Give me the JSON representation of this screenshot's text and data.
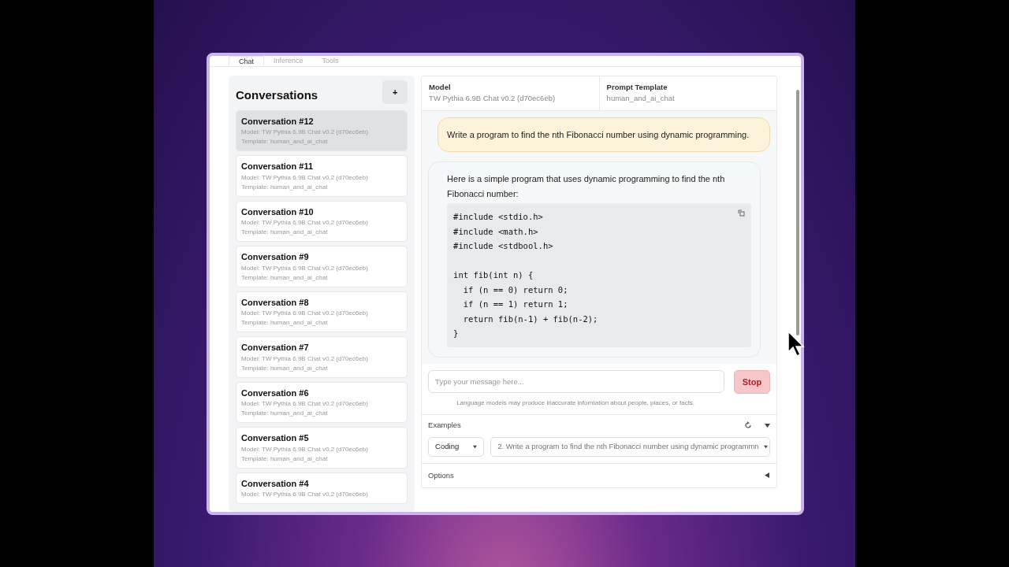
{
  "tabs": [
    {
      "label": "Chat",
      "selected": true
    },
    {
      "label": "Inference",
      "selected": false
    },
    {
      "label": "Tools",
      "selected": false
    }
  ],
  "sidebar": {
    "title": "Conversations",
    "add_button": "+",
    "conversations": [
      {
        "title": "Conversation #12",
        "model": "Model: TW Pythia 6.9B Chat v0.2 (d70ec6eb)",
        "template": "Template: human_and_ai_chat",
        "selected": true
      },
      {
        "title": "Conversation #11",
        "model": "Model: TW Pythia 6.9B Chat v0.2 (d70ec6eb)",
        "template": "Template: human_and_ai_chat",
        "selected": false
      },
      {
        "title": "Conversation #10",
        "model": "Model: TW Pythia 6.9B Chat v0.2 (d70ec6eb)",
        "template": "Template: human_and_ai_chat",
        "selected": false
      },
      {
        "title": "Conversation #9",
        "model": "Model: TW Pythia 6.9B Chat v0.2 (d70ec6eb)",
        "template": "Template: human_and_ai_chat",
        "selected": false
      },
      {
        "title": "Conversation #8",
        "model": "Model: TW Pythia 6.9B Chat v0.2 (d70ec6eb)",
        "template": "Template: human_and_ai_chat",
        "selected": false
      },
      {
        "title": "Conversation #7",
        "model": "Model: TW Pythia 6.9B Chat v0.2 (d70ec6eb)",
        "template": "Template: human_and_ai_chat",
        "selected": false
      },
      {
        "title": "Conversation #6",
        "model": "Model: TW Pythia 6.9B Chat v0.2 (d70ec6eb)",
        "template": "Template: human_and_ai_chat",
        "selected": false
      },
      {
        "title": "Conversation #5",
        "model": "Model: TW Pythia 6.9B Chat v0.2 (d70ec6eb)",
        "template": "Template: human_and_ai_chat",
        "selected": false
      },
      {
        "title": "Conversation #4",
        "model": "Model: TW Pythia 6.9B Chat v0.2 (d70ec6eb)",
        "selected": false
      }
    ]
  },
  "header": {
    "fields": [
      {
        "label": "Model",
        "value": "TW Pythia 6.9B Chat v0.2 (d70ec6eb)"
      },
      {
        "label": "Prompt Template",
        "value": "human_and_ai_chat"
      }
    ]
  },
  "messages": [
    {
      "kind": "user",
      "text": "Write a program to find the nth Fibonacci number using dynamic programming."
    },
    {
      "kind": "assistant",
      "text": "Here is a simple program that uses dynamic programming to find the nth Fibonacci number:",
      "code": "#include <stdio.h>\n#include <math.h>\n#include <stdbool.h>\n\nint fib(int n) {\n  if (n == 0) return 0;\n  if (n == 1) return 1;\n  return fib(n-1) + fib(n-2);\n}"
    }
  ],
  "composer": {
    "placeholder": "Type your message here...",
    "button": "Stop",
    "disclaimer": "Language models may produce inaccurate information about people, places, or facts."
  },
  "examples": {
    "label": "Examples",
    "expanded": true,
    "category": "Coding",
    "prompt": "2. Write a program to find the nth Fibonacci number using dynamic programmn"
  },
  "options": {
    "label": "Options",
    "expanded": false
  }
}
